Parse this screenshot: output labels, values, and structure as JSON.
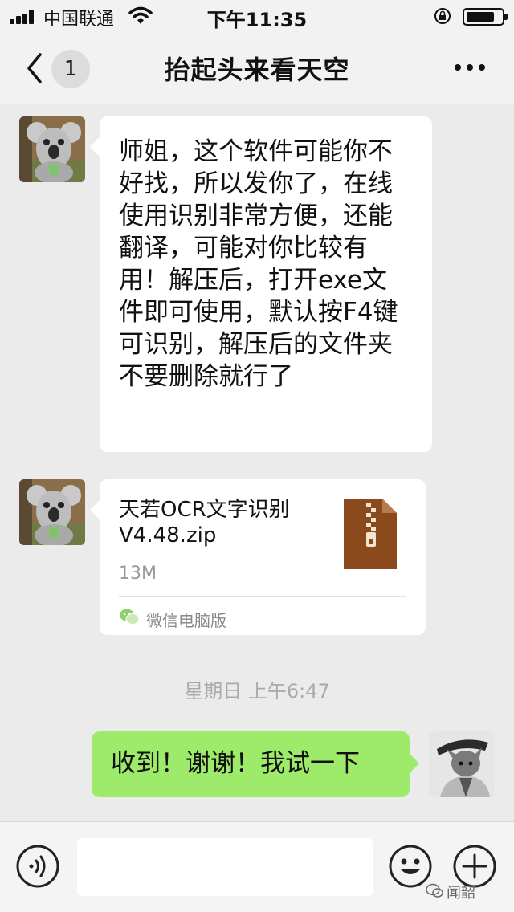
{
  "status_bar": {
    "carrier": "中国联通",
    "time": "下午11:35",
    "battery_level": 0.8,
    "icons": [
      "signal-icon",
      "wifi-icon",
      "orientation-lock-icon",
      "battery-icon"
    ]
  },
  "nav": {
    "unread_count": "1",
    "title": "抬起头来看天空",
    "icons": [
      "back-icon",
      "more-icon"
    ]
  },
  "messages": [
    {
      "side": "left",
      "type": "text",
      "text": "师姐，这个软件可能你不好找，所以发你了，在线使用识别非常方便，还能翻译，可能对你比较有用！解压后，打开exe文件即可使用，默认按F4键可识别，解压后的文件夹不要删除就行了"
    },
    {
      "side": "left",
      "type": "file",
      "file_name": "天若OCR文字识别V4.48.zip",
      "file_size": "13M",
      "source": "微信电脑版",
      "icons": [
        "zip-file-icon",
        "wechat-icon"
      ]
    },
    {
      "side": "right",
      "type": "text",
      "text": "收到！谢谢！我试一下"
    }
  ],
  "time_divider": "星期日 上午6:47",
  "input_bar": {
    "placeholder": "",
    "icons": [
      "voice-icon",
      "emoji-icon",
      "add-icon"
    ]
  },
  "watermark": "闻韶",
  "colors": {
    "background": "#ebebeb",
    "bar": "#f2f2f2",
    "outgoing_bubble": "#9eea6a",
    "incoming_bubble": "#ffffff",
    "zip_icon": "#8b4a1c"
  }
}
